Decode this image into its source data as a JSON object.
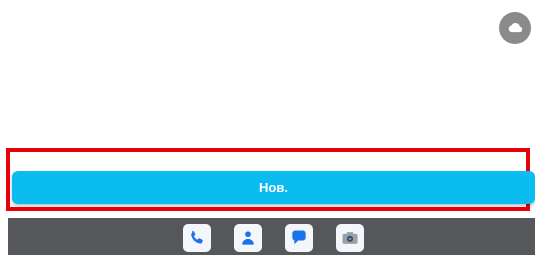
{
  "main": {
    "new_button_label": "Нов."
  },
  "icons": {
    "cloud": "cloud-icon",
    "dock": [
      "phone-icon",
      "contacts-icon",
      "messages-icon",
      "camera-icon"
    ]
  },
  "colors": {
    "accent": "#0bbcf0",
    "highlight": "#e8000b",
    "dock_background": "#56575b",
    "fab_background": "#8a8a8a"
  }
}
